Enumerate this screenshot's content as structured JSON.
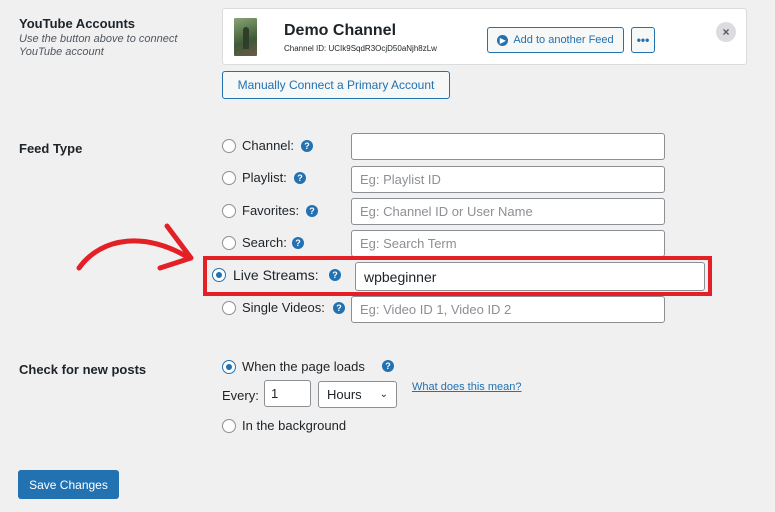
{
  "youtube_accounts": {
    "title": "YouTube Accounts",
    "help": "Use the button above to connect YouTube account",
    "channel_name": "Demo Channel",
    "channel_id_label": "Channel ID: UCIk9SqdR3OcjD50aNjh8zLw",
    "add_feed_label": "Add to another Feed",
    "more_label": "•••",
    "close_label": "×",
    "manual_connect_label": "Manually Connect a Primary Account"
  },
  "feed_type": {
    "title": "Feed Type",
    "options": [
      {
        "label": "Channel:",
        "value": "",
        "placeholder": "",
        "selected": false
      },
      {
        "label": "Playlist:",
        "value": "",
        "placeholder": "Eg: Playlist ID",
        "selected": false
      },
      {
        "label": "Favorites:",
        "value": "",
        "placeholder": "Eg: Channel ID or User Name",
        "selected": false
      },
      {
        "label": "Search:",
        "value": "",
        "placeholder": "Eg: Search Term",
        "selected": false
      },
      {
        "label": "Live Streams:",
        "value": "wpbeginner",
        "placeholder": "",
        "selected": true
      },
      {
        "label": "Single Videos:",
        "value": "",
        "placeholder": "Eg: Video ID 1, Video ID 2",
        "selected": false
      }
    ],
    "help_icon": "?"
  },
  "check_new_posts": {
    "title": "Check for new posts",
    "option_page_load": "When the page loads",
    "every_label": "Every:",
    "every_value": "1",
    "unit_value": "Hours",
    "what_link": "What does this mean?",
    "option_background": "In the background"
  },
  "save_label": "Save Changes",
  "colors": {
    "accent": "#2271b1",
    "highlight": "#e42027",
    "background": "#f0f0f1"
  }
}
